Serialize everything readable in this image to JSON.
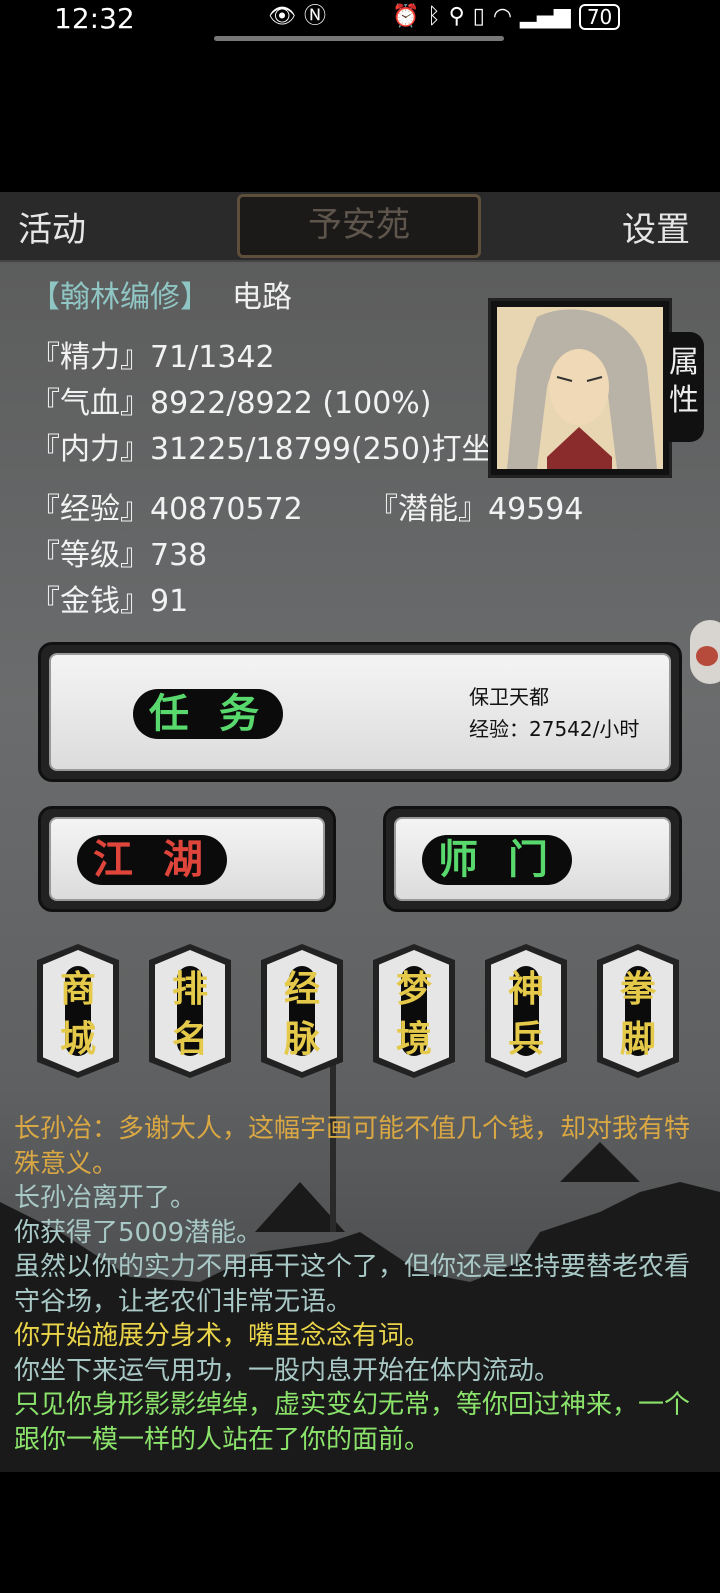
{
  "status_bar": {
    "time": "12:32",
    "battery": "70"
  },
  "top_bar": {
    "left_button": "活动",
    "location": "予安苑",
    "right_button": "设置"
  },
  "character": {
    "rank": "【翰林编修】",
    "route": "电路",
    "attr_tab": "属\n性",
    "stats": [
      "『精力』71/1342",
      "『气血』8922/8922 (100%)",
      "『内力』31225/18799(250)打坐",
      "『经验』40870572",
      "『等级』738",
      "『金钱』91"
    ],
    "potential": "『潜能』49594"
  },
  "task": {
    "label": "任 务",
    "name": "保卫天都",
    "rate": "经验：27542/小时"
  },
  "jianghu": {
    "label": "江 湖"
  },
  "shimen": {
    "label": "师 门"
  },
  "menu": [
    {
      "top": "商",
      "bottom": "城"
    },
    {
      "top": "排",
      "bottom": "名"
    },
    {
      "top": "经",
      "bottom": "脉"
    },
    {
      "top": "梦",
      "bottom": "境"
    },
    {
      "top": "神",
      "bottom": "兵"
    },
    {
      "top": "拳",
      "bottom": "脚"
    }
  ],
  "log": [
    {
      "text": "长孙冶：多谢大人，这幅字画可能不值几个钱，却对我有特殊意义。",
      "color": "#d9a743"
    },
    {
      "text": "长孙冶离开了。",
      "color": "#a9c9c7"
    },
    {
      "text": "你获得了5009潜能。",
      "color": "#a9c9c7"
    },
    {
      "text": "虽然以你的实力不用再干这个了，但你还是坚持要替老农看守谷场，让老农们非常无语。",
      "color": "#a9c9c7"
    },
    {
      "text": "你开始施展分身术，嘴里念念有词。",
      "color": "#e8d34a"
    },
    {
      "text": "你坐下来运气用功，一股内息开始在体内流动。",
      "color": "#a9c9c7"
    },
    {
      "text": "只见你身形影影绰绰，虚实变幻无常，等你回过神来，一个跟你一模一样的人站在了你的面前。",
      "color": "#8be36b"
    }
  ]
}
